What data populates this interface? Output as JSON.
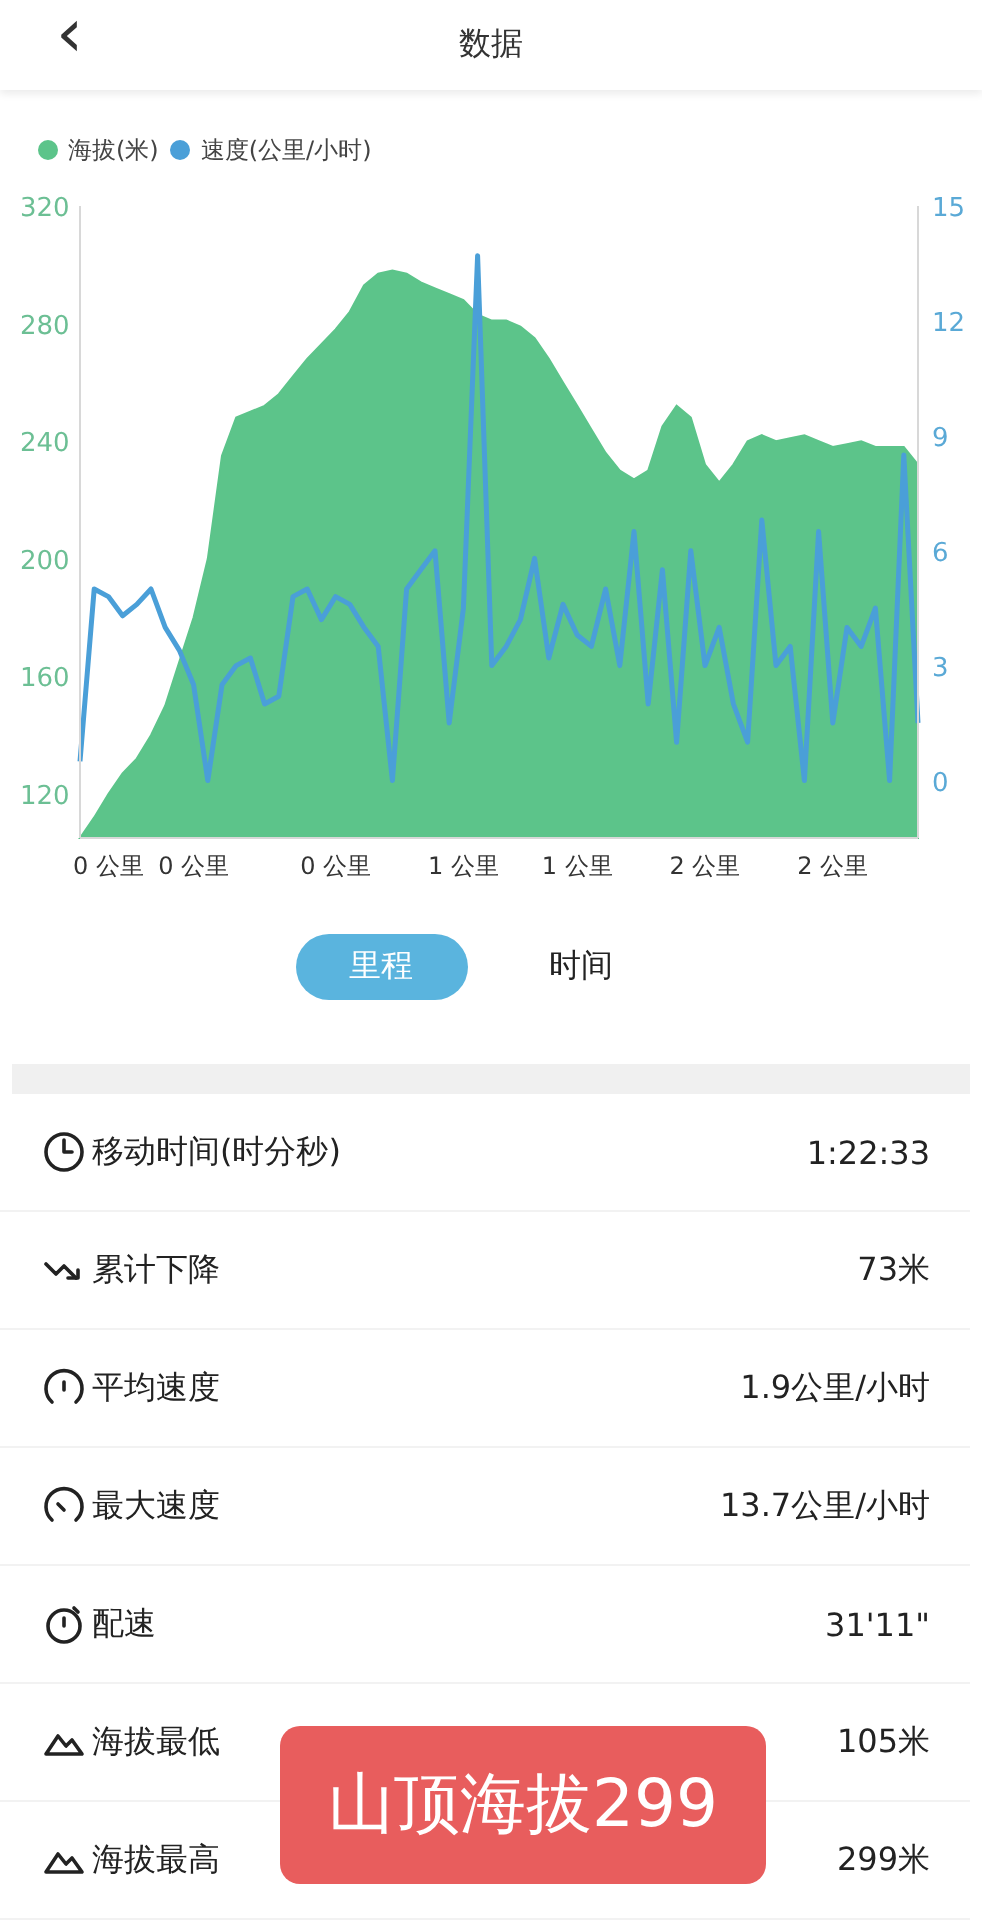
{
  "header": {
    "back_icon": "‹",
    "title": "数据"
  },
  "chart": {
    "chart_data": {
      "type": "area",
      "categories": [
        null,
        null,
        "0 公里",
        null,
        null,
        null,
        null,
        null,
        "0 公里",
        null,
        null,
        null,
        null,
        null,
        null,
        null,
        null,
        null,
        "0 公里",
        null,
        null,
        null,
        null,
        null,
        null,
        null,
        null,
        "1 公里",
        null,
        null,
        null,
        null,
        null,
        null,
        null,
        "1 公里",
        null,
        null,
        null,
        null,
        null,
        null,
        null,
        null,
        "2 公里",
        null,
        null,
        null,
        null,
        null,
        null,
        null,
        null,
        "2 公里",
        null,
        null,
        null,
        null,
        null,
        null
      ],
      "series": [
        {
          "name": "海拔(米)",
          "color": "#5cc48a",
          "values": [
            105,
            112,
            120,
            127,
            132,
            140,
            150,
            165,
            180,
            200,
            235,
            248,
            250,
            252,
            256,
            262,
            268,
            273,
            278,
            284,
            293,
            297,
            298,
            297,
            294,
            292,
            290,
            288,
            283,
            281,
            281,
            279,
            275,
            268,
            260,
            252,
            244,
            236,
            230,
            227,
            230,
            245,
            252,
            248,
            232,
            226,
            232,
            240,
            242,
            240,
            241,
            242,
            240,
            238,
            239,
            240,
            238,
            238,
            238,
            232
          ]
        },
        {
          "name": "速度(公里/小时)",
          "color": "#4a9fd8",
          "type": "line",
          "axis": "y2",
          "values": [
            0.5,
            5,
            4.8,
            4.3,
            4.6,
            5,
            4,
            3.4,
            2.5,
            0,
            2.5,
            3,
            3.2,
            2,
            2.2,
            4.8,
            5,
            4.2,
            4.8,
            4.6,
            4,
            3.5,
            0,
            5,
            5.5,
            6,
            1.5,
            4.5,
            13.7,
            3,
            3.5,
            4.2,
            5.8,
            3.2,
            4.6,
            3.8,
            3.5,
            5,
            3,
            6.5,
            2,
            5.5,
            1,
            6,
            3,
            4,
            2,
            1,
            6.8,
            3,
            3.5,
            0,
            6.5,
            1.5,
            4,
            3.5,
            4.5,
            0,
            8.5,
            1.5
          ]
        }
      ],
      "ylim": [
        105,
        320
      ],
      "yticks": [
        120,
        160,
        200,
        240,
        280,
        320
      ],
      "y2lim": [
        -1.5,
        15
      ],
      "y2ticks": [
        0,
        3,
        6,
        9,
        12,
        15
      ]
    }
  },
  "toggle": [
    {
      "label": "里程",
      "selected": true
    },
    {
      "label": "时间",
      "selected": false
    }
  ],
  "stats": [
    {
      "kind": "clock",
      "label": "移动时间(时分秒)",
      "value": "1:22:33"
    },
    {
      "kind": "descent",
      "label": "累计下降",
      "value": "73米"
    },
    {
      "kind": "gauge",
      "label": "平均速度",
      "value": "1.9公里/小时"
    },
    {
      "kind": "gauge-max",
      "label": "最大速度",
      "value": "13.7公里/小时"
    },
    {
      "kind": "stopwatch",
      "label": "配速",
      "value": "31'11\""
    },
    {
      "kind": "mountain",
      "label": "海拔最低",
      "value": "105米"
    },
    {
      "kind": "mountain",
      "label": "海拔最高",
      "value": "299米"
    }
  ],
  "overlay_label": "山顶海拔299"
}
